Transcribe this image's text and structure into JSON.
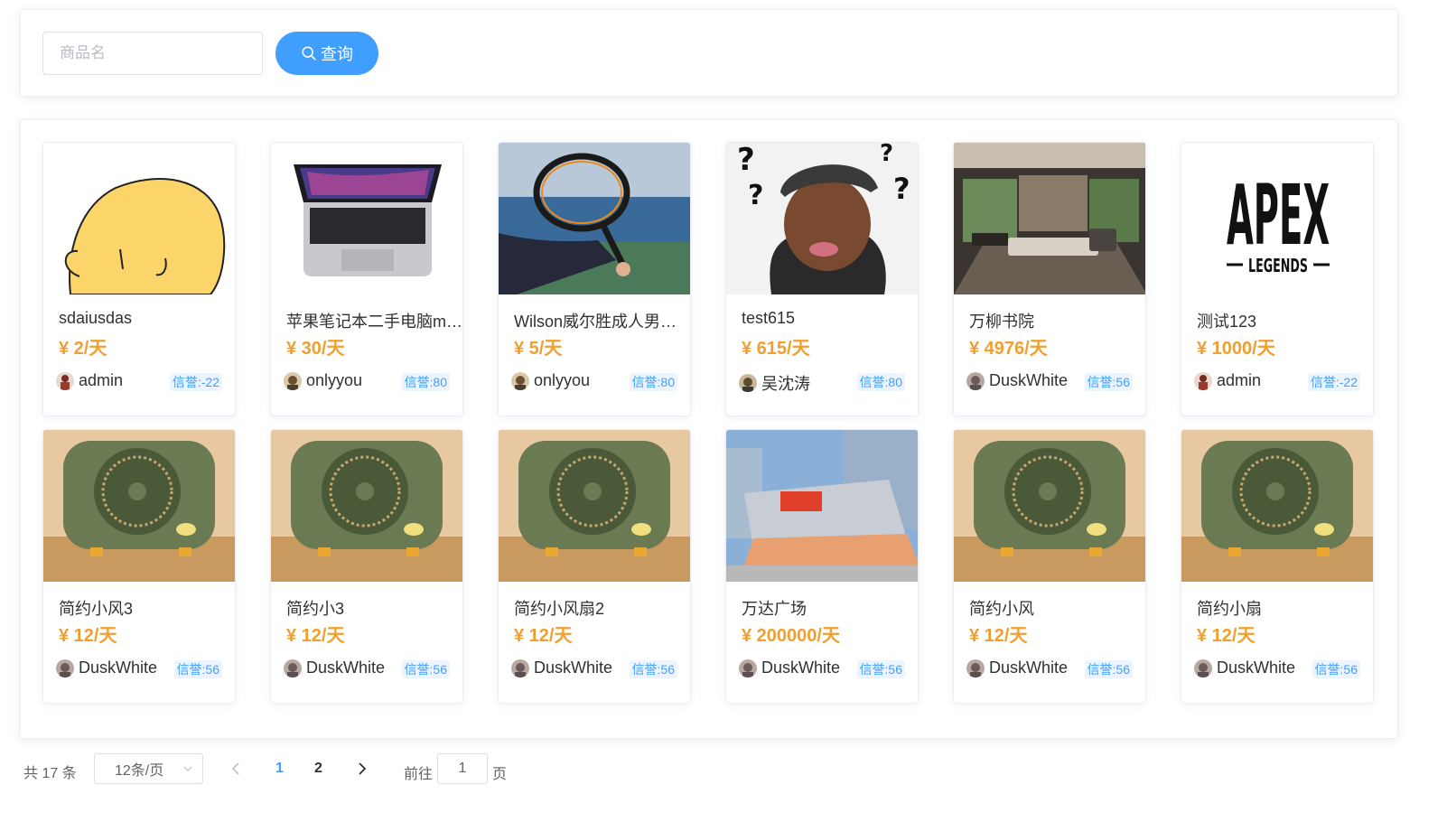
{
  "search": {
    "placeholder": "商品名",
    "button_label": "查询"
  },
  "items": [
    {
      "title": "sdaiusdas",
      "price": "¥ 2/天",
      "owner": "admin",
      "credit": "信誉:-22",
      "image": "yellow-blob-drawing"
    },
    {
      "title": "苹果笔记本二手电脑macbook",
      "price": "¥ 30/天",
      "owner": "onlyyou",
      "credit": "信誉:80",
      "image": "laptop-photo"
    },
    {
      "title": "Wilson威尔胜成人男士网球拍",
      "price": "¥ 5/天",
      "owner": "onlyyou",
      "credit": "信誉:80",
      "image": "tennis-racket-photo"
    },
    {
      "title": "test615",
      "price": "¥ 615/天",
      "owner": "吴沈涛",
      "credit": "信誉:80",
      "image": "confused-man-meme"
    },
    {
      "title": "万柳书院",
      "price": "¥ 4976/天",
      "owner": "DuskWhite",
      "credit": "信誉:56",
      "image": "living-room-photo"
    },
    {
      "title": "测试123",
      "price": "¥ 1000/天",
      "owner": "admin",
      "credit": "信誉:-22",
      "image": "apex-legends-logo"
    },
    {
      "title": "简约小风3",
      "price": "¥ 12/天",
      "owner": "DuskWhite",
      "credit": "信誉:56",
      "image": "green-fan-photo"
    },
    {
      "title": "简约小3",
      "price": "¥ 12/天",
      "owner": "DuskWhite",
      "credit": "信誉:56",
      "image": "green-fan-photo"
    },
    {
      "title": "简约小风扇2",
      "price": "¥ 12/天",
      "owner": "DuskWhite",
      "credit": "信誉:56",
      "image": "green-fan-photo"
    },
    {
      "title": "万达广场",
      "price": "¥ 200000/天",
      "owner": "DuskWhite",
      "credit": "信誉:56",
      "image": "wanda-plaza-photo"
    },
    {
      "title": "简约小风",
      "price": "¥ 12/天",
      "owner": "DuskWhite",
      "credit": "信誉:56",
      "image": "green-fan-photo"
    },
    {
      "title": "简约小扇",
      "price": "¥ 12/天",
      "owner": "DuskWhite",
      "credit": "信誉:56",
      "image": "green-fan-photo"
    }
  ],
  "pagination": {
    "total": "共 17 条",
    "page_size": "12条/页",
    "pages": [
      "1",
      "2"
    ],
    "current_page": "1",
    "goto_label": "前往",
    "goto_value": "1",
    "page_suffix": "页"
  },
  "colors": {
    "accent": "#409eff",
    "price": "#f0a030"
  }
}
